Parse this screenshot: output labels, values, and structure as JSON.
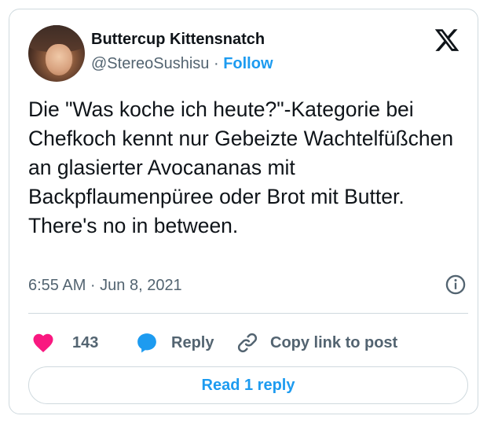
{
  "author": {
    "name": "Buttercup Kittensnatch",
    "handle": "@StereoSushisu",
    "separator": "·",
    "follow_label": "Follow"
  },
  "tweet": {
    "text": "Die \"Was koche ich heute?\"-Kategorie bei Chefkoch kennt nur Gebeizte Wachtelfüßchen an glasierter Avocananas mit Backpflaumenpüree oder Brot mit Butter. There's no in between.",
    "timestamp": "6:55 AM · Jun 8, 2021"
  },
  "actions": {
    "like_count": "143",
    "reply_label": "Reply",
    "copy_label": "Copy link to post"
  },
  "read_replies_label": "Read 1 reply",
  "colors": {
    "accent": "#1d9bf0",
    "like": "#f91880",
    "secondary_text": "#536471",
    "border": "#cfd9de"
  },
  "icons": [
    "x-logo-icon",
    "info-icon",
    "heart-icon",
    "reply-bubble-icon",
    "link-icon"
  ]
}
